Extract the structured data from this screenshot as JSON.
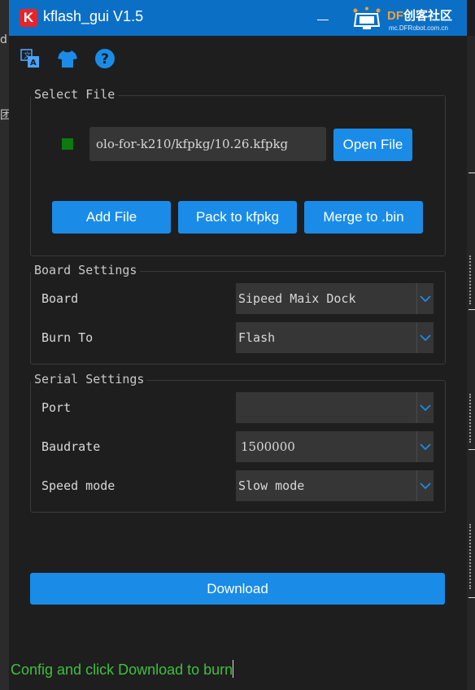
{
  "window": {
    "title": "kflash_gui V1.5",
    "app_icon_letter": "K",
    "accent_color": "#0b6fc6"
  },
  "watermark": {
    "brand_prefix": "DF",
    "brand_suffix": "创客社区",
    "url": "mc.DFRobot.com.cn"
  },
  "background_fragments": [
    "d",
    "团"
  ],
  "toolbar": {
    "icons": [
      "language-icon",
      "skin-icon",
      "help-icon"
    ]
  },
  "select_file": {
    "title": "Select File",
    "file_path": "olo-for-k210/kfpkg/10.26.kfpkg",
    "status_color": "#0c7a0c",
    "open_file_label": "Open File",
    "add_file_label": "Add File",
    "pack_label": "Pack to kfpkg",
    "merge_label": "Merge to .bin"
  },
  "board_settings": {
    "title": "Board Settings",
    "board_label": "Board",
    "board_value": "Sipeed Maix Dock",
    "burn_to_label": "Burn To",
    "burn_to_value": "Flash"
  },
  "serial_settings": {
    "title": "Serial Settings",
    "port_label": "Port",
    "port_value": "",
    "baudrate_label": "Baudrate",
    "baudrate_value": "1500000",
    "speed_mode_label": "Speed mode",
    "speed_mode_value": "Slow mode"
  },
  "download_label": "Download",
  "status_text": "Config and click Download to burn",
  "status_color": "#3fbf3f"
}
